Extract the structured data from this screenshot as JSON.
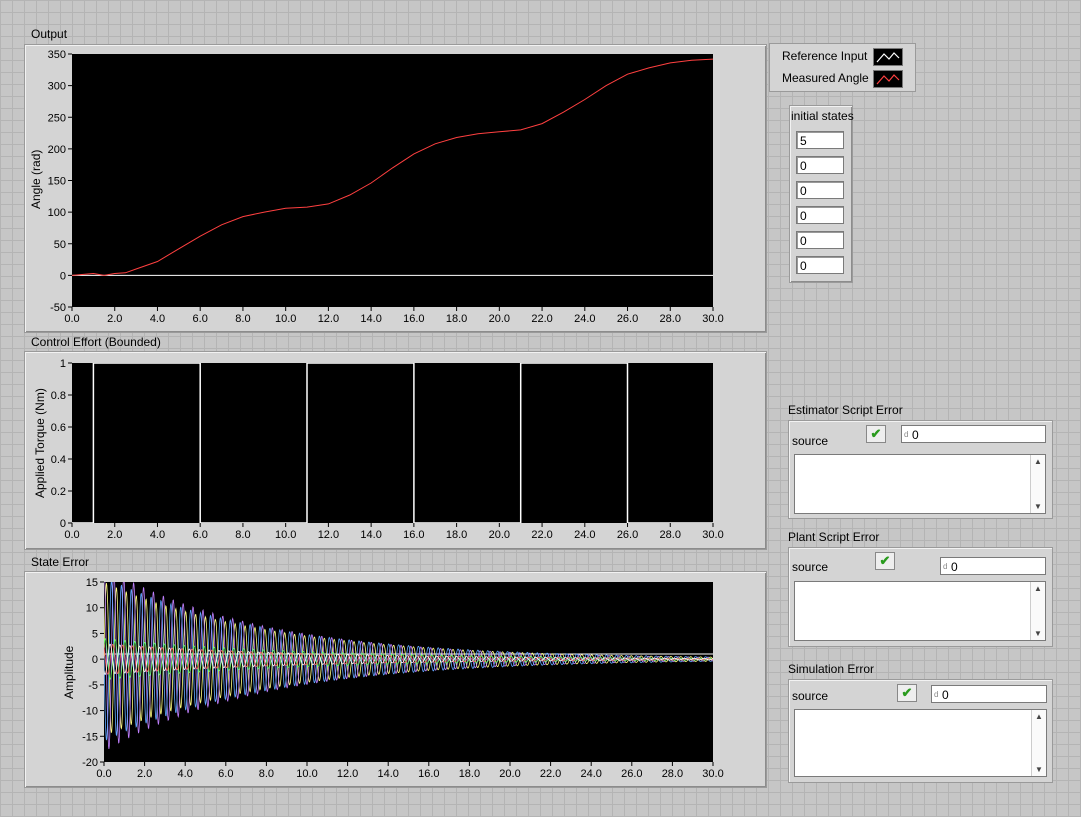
{
  "charts": {
    "output": {
      "title": "Output",
      "ylabel": "Angle (rad)",
      "legend": [
        {
          "label": "Reference Input",
          "color": "#ffffff"
        },
        {
          "label": "Measured Angle",
          "color": "#ff4040"
        }
      ]
    },
    "control": {
      "title": "Control Effort (Bounded)",
      "ylabel": "Applied Torque (Nm)"
    },
    "state": {
      "title": "State Error",
      "ylabel": "Amplitude"
    }
  },
  "chart_data": [
    {
      "type": "line",
      "title": "Output",
      "xlabel": "",
      "ylabel": "Angle (rad)",
      "xlim": [
        0,
        30
      ],
      "ylim": [
        -50,
        350
      ],
      "xticks": [
        "0.0",
        "2.0",
        "4.0",
        "6.0",
        "8.0",
        "10.0",
        "12.0",
        "14.0",
        "16.0",
        "18.0",
        "20.0",
        "22.0",
        "24.0",
        "26.0",
        "28.0",
        "30.0"
      ],
      "yticks": [
        "350",
        "300",
        "250",
        "200",
        "150",
        "100",
        "50",
        "0",
        "-50"
      ],
      "legend_position": "top-right",
      "grid": false,
      "series": [
        {
          "name": "Reference Input",
          "color": "#ffffff",
          "x": [
            0,
            30
          ],
          "y": [
            0,
            0
          ]
        },
        {
          "name": "Measured Angle",
          "color": "#ff4040",
          "x": [
            0,
            1,
            1.5,
            2,
            2.5,
            3,
            4,
            5,
            6,
            7,
            8,
            9,
            10,
            11,
            12,
            13,
            14,
            15,
            16,
            17,
            18,
            19,
            20,
            21,
            22,
            23,
            24,
            25,
            26,
            27,
            28,
            29,
            30
          ],
          "y": [
            0,
            3,
            0,
            3,
            4,
            10,
            22,
            42,
            62,
            80,
            93,
            100,
            106,
            108,
            113,
            127,
            146,
            170,
            192,
            208,
            218,
            224,
            227,
            230,
            240,
            258,
            278,
            300,
            318,
            328,
            336,
            340,
            342
          ]
        }
      ]
    },
    {
      "type": "line",
      "title": "Control Effort (Bounded)",
      "xlabel": "",
      "ylabel": "Applied Torque (Nm)",
      "xlim": [
        0,
        30
      ],
      "ylim": [
        0,
        1
      ],
      "xticks": [
        "0.0",
        "2.0",
        "4.0",
        "6.0",
        "8.0",
        "10.0",
        "12.0",
        "14.0",
        "16.0",
        "18.0",
        "20.0",
        "22.0",
        "24.0",
        "26.0",
        "28.0",
        "30.0"
      ],
      "yticks": [
        "1",
        "0.8",
        "0.6",
        "0.4",
        "0.2",
        "0"
      ],
      "grid": false,
      "series": [
        {
          "color": "#ffffff",
          "x": [
            0,
            1,
            1,
            6,
            6,
            11,
            11,
            16,
            16,
            21,
            21,
            26,
            26,
            30
          ],
          "y": [
            0,
            0,
            1,
            1,
            0,
            0,
            1,
            1,
            0,
            0,
            1,
            1,
            0,
            0
          ]
        }
      ]
    },
    {
      "type": "line",
      "title": "State Error",
      "xlabel": "",
      "ylabel": "Amplitude",
      "xlim": [
        0,
        30
      ],
      "ylim": [
        -20,
        15
      ],
      "xticks": [
        "0.0",
        "2.0",
        "4.0",
        "6.0",
        "8.0",
        "10.0",
        "12.0",
        "14.0",
        "16.0",
        "18.0",
        "20.0",
        "22.0",
        "24.0",
        "26.0",
        "28.0",
        "30.0"
      ],
      "yticks": [
        "15",
        "10",
        "5",
        "0",
        "-5",
        "-10",
        "-15",
        "-20"
      ],
      "grid": false,
      "series": [
        {
          "color": "#ffff80",
          "initial_amplitude": 15,
          "decay_rate": 0.12,
          "freq_hz": 2.05,
          "phase": 0.0
        },
        {
          "color": "#c080ff",
          "initial_amplitude": 18,
          "decay_rate": 0.13,
          "freq_hz": 2.05,
          "phase": 1.6
        },
        {
          "color": "#60a8ff",
          "initial_amplitude": 16,
          "decay_rate": 0.12,
          "freq_hz": 2.05,
          "phase": 3.1
        },
        {
          "color": "#60ff60",
          "initial_amplitude": 4,
          "decay_rate": 0.1,
          "freq_hz": 2.05,
          "phase": 0.8
        },
        {
          "color": "#ff6060",
          "initial_amplitude": 3,
          "decay_rate": 0.1,
          "freq_hz": 2.05,
          "phase": 2.3
        },
        {
          "color": "#ffffff",
          "initial_amplitude": 3,
          "decay_rate": 0.1,
          "freq_hz": 2.05,
          "phase": 4.0
        }
      ]
    }
  ],
  "initial_states": {
    "title": "initial states",
    "values": [
      "5",
      "0",
      "0",
      "0",
      "0",
      "0"
    ]
  },
  "errors": [
    {
      "title": "Estimator Script Error",
      "source_label": "source",
      "code": "0",
      "source": ""
    },
    {
      "title": "Plant Script Error",
      "source_label": "source",
      "code": "0",
      "source": ""
    },
    {
      "title": "Simulation Error",
      "source_label": "source",
      "code": "0",
      "source": ""
    }
  ]
}
